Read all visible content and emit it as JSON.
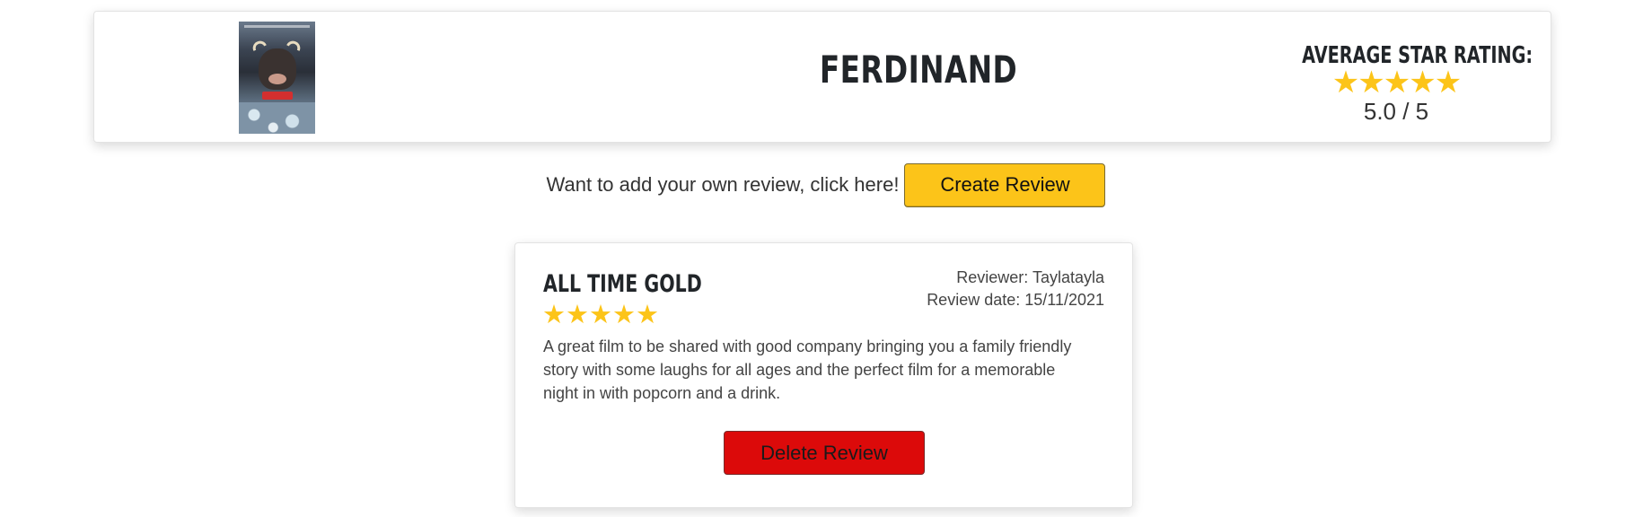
{
  "movie": {
    "title": "FERDINAND",
    "poster_icon": "movie-poster"
  },
  "rating": {
    "label": "AVERAGE STAR RATING:",
    "stars": "★★★★★",
    "score": "5.0 / 5",
    "value": 5.0,
    "max": 5,
    "star_color": "#fcc419"
  },
  "cta": {
    "text": "Want to add your own review, click here!",
    "button_label": "Create Review",
    "button_color": "#fcc419"
  },
  "review": {
    "title": "ALL TIME GOLD",
    "stars": "★★★★★",
    "star_count": 5,
    "reviewer": "Reviewer: Taylatayla",
    "date": "Review date: 15/11/2021",
    "body": "A great film to be shared with good company bringing you a family friendly story with some laughs for all ages and the perfect film for a memorable night in with popcorn and a drink.",
    "delete_label": "Delete Review",
    "delete_color": "#dc0a0a"
  }
}
